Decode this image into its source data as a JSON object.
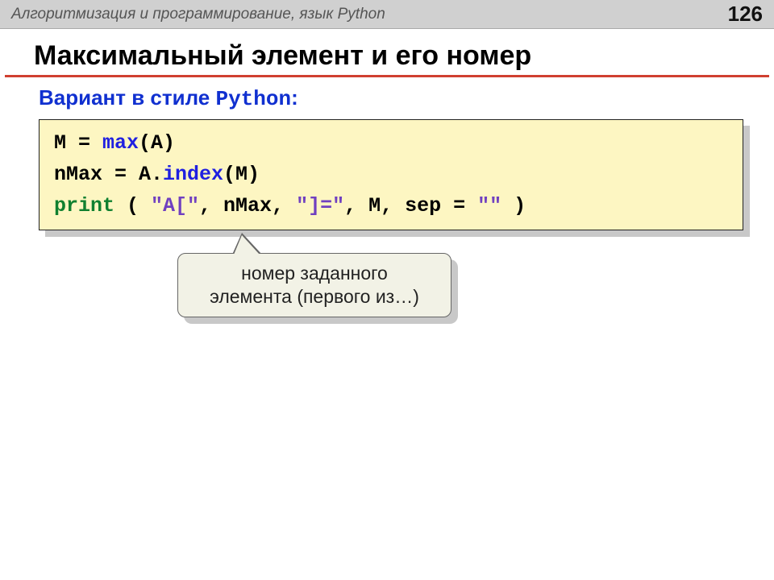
{
  "header": {
    "breadcrumb": "Алгоритмизация и программирование, язык Python",
    "page_number": "126"
  },
  "title": "Максимальный элемент и его номер",
  "subtitle": {
    "prefix": "Вариант в стиле ",
    "lang": "Python",
    "suffix": ":"
  },
  "code": {
    "line1_lhs": "M = ",
    "line1_fn": "max",
    "line1_args": "(A)",
    "line2_lhs": "nMax = A.",
    "line2_fn": "index",
    "line2_args": "(M)",
    "line3_fn": "print",
    "line3_open": " ( ",
    "line3_s1": "\"A[\"",
    "line3_c1": ", nMax, ",
    "line3_s2": "\"]=\"",
    "line3_c2": ", M, sep = ",
    "line3_s3": "\"\"",
    "line3_close": " )"
  },
  "callout": {
    "line1": "номер заданного",
    "line2": "элемента (первого из…)"
  }
}
